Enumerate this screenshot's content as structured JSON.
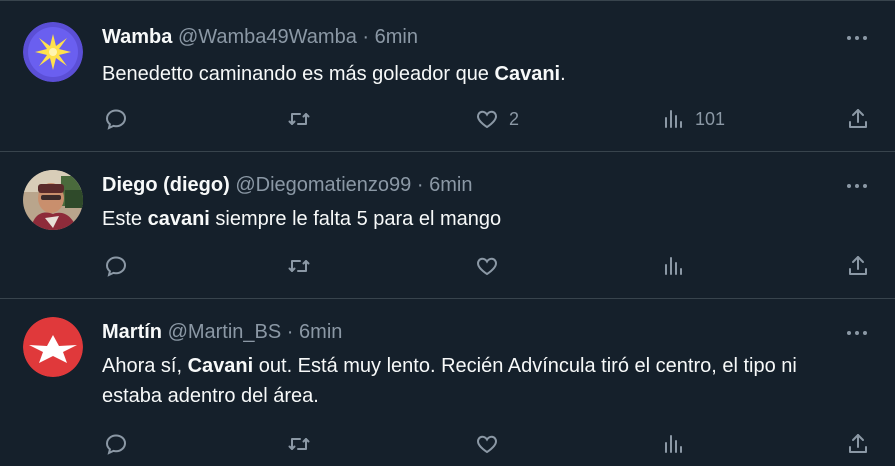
{
  "tweets": [
    {
      "name": "Wamba",
      "handle": "@Wamba49Wamba",
      "separator": "·",
      "time": "6min",
      "text_parts": [
        "Benedetto caminando es más goleador que ",
        "Cavani",
        "."
      ],
      "likes": "2",
      "views": "101",
      "avatar_icon": "eight-point-star-icon",
      "avatar_colors": {
        "bg": "#5b4fd6",
        "star": "#ffe14d"
      }
    },
    {
      "name": "Diego (diego)",
      "handle": "@Diegomatienzo99",
      "separator": "·",
      "time": "6min",
      "text_parts": [
        "Este ",
        "cavani",
        " siempre le falta 5 para el mango"
      ],
      "likes": "",
      "views": "",
      "avatar_icon": "person-photo-avatar"
    },
    {
      "name": "Martín",
      "handle": "@Martin_BS",
      "separator": "·",
      "time": "6min",
      "text_parts": [
        "Ahora sí, ",
        "Cavani",
        " out. Está muy lento. Recién Advíncula tiró el centro, el tipo ni estaba adentro del área."
      ],
      "likes": "",
      "views": "",
      "avatar_icon": "star-wings-icon",
      "avatar_colors": {
        "bg": "#e0393b",
        "star": "#ffffff"
      }
    }
  ],
  "icons": {
    "reply": "reply-icon",
    "retweet": "retweet-icon",
    "like": "heart-icon",
    "views": "views-icon",
    "share": "share-icon",
    "more": "more-icon"
  },
  "colors": {
    "background": "#15202b",
    "text": "#f7f9f9",
    "muted": "#8b98a5",
    "divider": "#38444d"
  }
}
